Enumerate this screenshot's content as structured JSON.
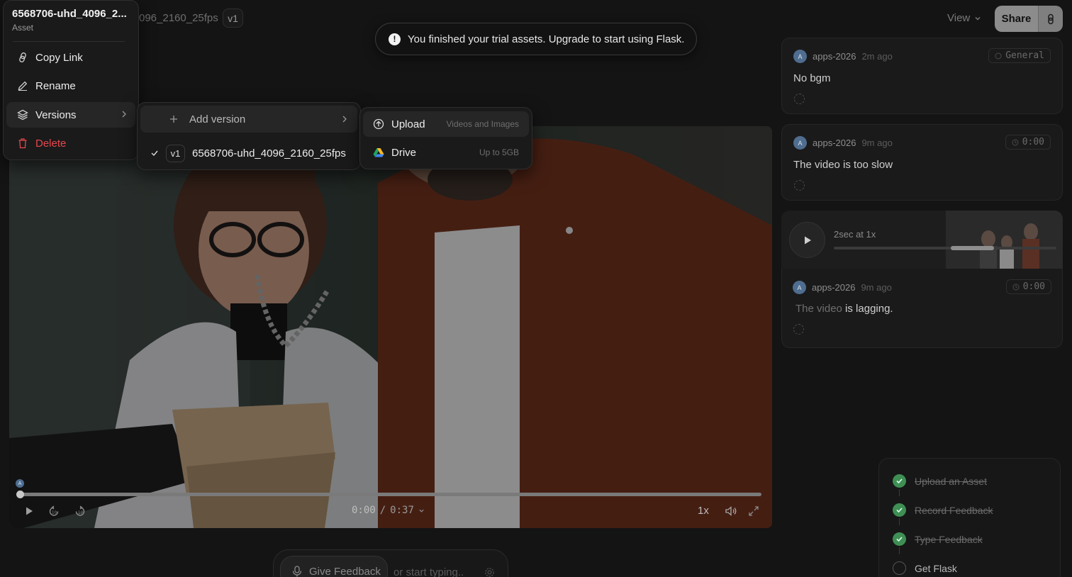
{
  "header": {
    "file_title_partial": "096_2160_25fps",
    "version_badge": "v1",
    "view_label": "View",
    "share_label": "Share"
  },
  "toast": {
    "message": "You finished your trial assets. Upgrade to start using Flask."
  },
  "context_menu": {
    "title": "6568706-uhd_4096_2...",
    "subtitle": "Asset",
    "items": [
      {
        "label": "Copy Link",
        "icon": "link-icon"
      },
      {
        "label": "Rename",
        "icon": "pencil-icon"
      },
      {
        "label": "Versions",
        "icon": "layers-icon",
        "has_submenu": true
      },
      {
        "label": "Delete",
        "icon": "trash-icon",
        "destructive": true
      }
    ]
  },
  "versions_submenu": {
    "add_label": "Add version",
    "versions": [
      {
        "badge": "v1",
        "name": "6568706-uhd_4096_2160_25fps",
        "selected": true
      }
    ]
  },
  "upload_submenu": {
    "items": [
      {
        "label": "Upload",
        "hint": "Videos and Images",
        "icon": "upload-icon"
      },
      {
        "label": "Drive",
        "hint": "Up to 5GB",
        "icon": "google-drive-icon"
      }
    ]
  },
  "player": {
    "current_time": "0:00",
    "separator": "/",
    "duration": "0:37",
    "speed": "1x",
    "progress": 0,
    "marker_avatar": "A"
  },
  "feedback_bar": {
    "give_feedback_label": "Give Feedback",
    "type_hint": "or start typing.."
  },
  "comments": [
    {
      "avatar": "A",
      "author": "apps-2026",
      "when": "2m ago",
      "tag": "General",
      "text": "No bgm"
    },
    {
      "avatar": "A",
      "author": "apps-2026",
      "when": "9m ago",
      "tag": "0:00",
      "text": "The video is too slow"
    },
    {
      "avatar": "A",
      "author": "apps-2026",
      "when": "9m ago",
      "tag": "0:00",
      "text_dim": "The video",
      "text": "is lagging.",
      "voice_label": "2sec at 1x"
    }
  ],
  "checklist": [
    {
      "label": "Upload an Asset",
      "done": true
    },
    {
      "label": "Record Feedback",
      "done": true
    },
    {
      "label": "Type Feedback",
      "done": true
    },
    {
      "label": "Get Flask",
      "done": false
    }
  ],
  "colors": {
    "background": "#141414",
    "accent_share": "#8c8c8c",
    "danger": "#e5484d",
    "success": "#3f8f54",
    "avatar": "#4f6d8f"
  }
}
